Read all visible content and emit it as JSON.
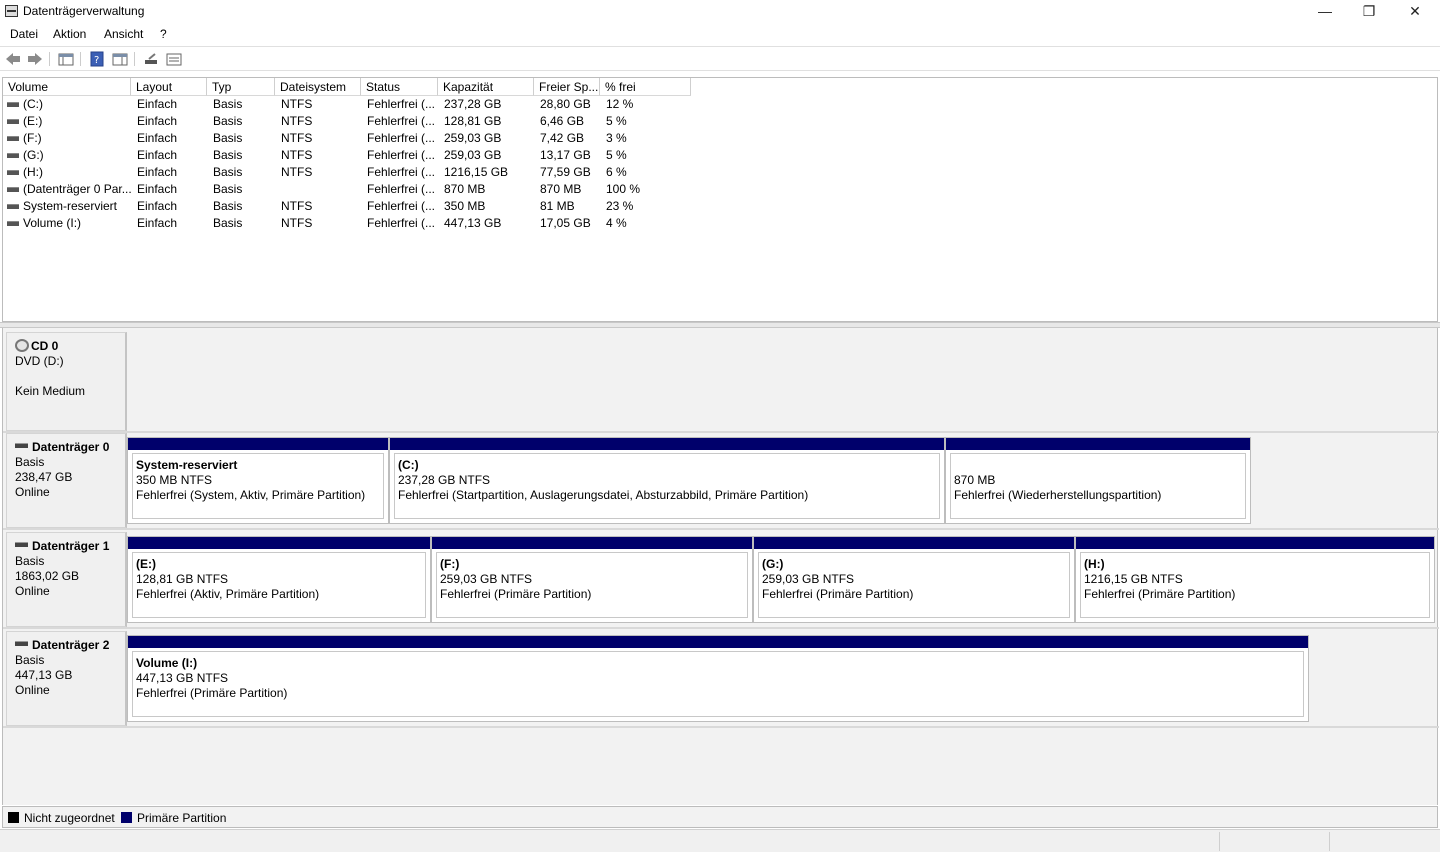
{
  "window": {
    "title": "Datenträgerverwaltung",
    "min": "—",
    "max": "❐",
    "close": "✕"
  },
  "menu": [
    {
      "label": "Datei"
    },
    {
      "label": "Aktion"
    },
    {
      "label": "Ansicht"
    },
    {
      "label": "?"
    }
  ],
  "toolbar": {
    "icons": [
      "back-arrow-icon",
      "forward-arrow-icon",
      "console-tree-icon",
      "help-icon",
      "properties-panel-icon",
      "rescan-disks-icon",
      "volume-list-icon"
    ]
  },
  "volume_table": {
    "columns": [
      "Volume",
      "Layout",
      "Typ",
      "Dateisystem",
      "Status",
      "Kapazität",
      "Freier Sp...",
      "% frei"
    ],
    "rows": [
      [
        "(C:)",
        "Einfach",
        "Basis",
        "NTFS",
        "Fehlerfrei (...",
        "237,28 GB",
        "28,80 GB",
        "12 %"
      ],
      [
        "(E:)",
        "Einfach",
        "Basis",
        "NTFS",
        "Fehlerfrei (...",
        "128,81 GB",
        "6,46 GB",
        "5 %"
      ],
      [
        "(F:)",
        "Einfach",
        "Basis",
        "NTFS",
        "Fehlerfrei (...",
        "259,03 GB",
        "7,42 GB",
        "3 %"
      ],
      [
        "(G:)",
        "Einfach",
        "Basis",
        "NTFS",
        "Fehlerfrei (...",
        "259,03 GB",
        "13,17 GB",
        "5 %"
      ],
      [
        "(H:)",
        "Einfach",
        "Basis",
        "NTFS",
        "Fehlerfrei (...",
        "1216,15 GB",
        "77,59 GB",
        "6 %"
      ],
      [
        "(Datenträger 0 Par...",
        "Einfach",
        "Basis",
        "",
        "Fehlerfrei (...",
        "870 MB",
        "870 MB",
        "100 %"
      ],
      [
        "System-reserviert",
        "Einfach",
        "Basis",
        "NTFS",
        "Fehlerfrei (...",
        "350 MB",
        "81 MB",
        "23 %"
      ],
      [
        "Volume (I:)",
        "Einfach",
        "Basis",
        "NTFS",
        "Fehlerfrei (...",
        "447,13 GB",
        "17,05 GB",
        "4 %"
      ]
    ]
  },
  "disks": {
    "cd0": {
      "name": "CD 0",
      "line1": "DVD (D:)",
      "line2": "",
      "line3": "Kein Medium"
    },
    "disk0": {
      "name": "Datenträger 0",
      "line1": "Basis",
      "line2": "238,47 GB",
      "line3": "Online",
      "partitions": [
        {
          "name": "System-reserviert",
          "size": "350 MB NTFS",
          "status": "Fehlerfrei (System, Aktiv, Primäre Partition)"
        },
        {
          "name": "(C:)",
          "size": "237,28 GB NTFS",
          "status": "Fehlerfrei (Startpartition, Auslagerungsdatei, Absturzabbild, Primäre Partition)"
        },
        {
          "name": "",
          "size": "870 MB",
          "status": "Fehlerfrei (Wiederherstellungspartition)"
        }
      ]
    },
    "disk1": {
      "name": "Datenträger 1",
      "line1": "Basis",
      "line2": "1863,02 GB",
      "line3": "Online",
      "partitions": [
        {
          "name": "(E:)",
          "size": "128,81 GB NTFS",
          "status": "Fehlerfrei (Aktiv, Primäre Partition)"
        },
        {
          "name": "(F:)",
          "size": "259,03 GB NTFS",
          "status": "Fehlerfrei (Primäre Partition)"
        },
        {
          "name": "(G:)",
          "size": "259,03 GB NTFS",
          "status": "Fehlerfrei (Primäre Partition)"
        },
        {
          "name": "(H:)",
          "size": "1216,15 GB NTFS",
          "status": "Fehlerfrei (Primäre Partition)"
        }
      ]
    },
    "disk2": {
      "name": "Datenträger 2",
      "line1": "Basis",
      "line2": "447,13 GB",
      "line3": "Online",
      "partitions": [
        {
          "name": "Volume  (I:)",
          "size": "447,13 GB NTFS",
          "status": "Fehlerfrei (Primäre Partition)"
        }
      ]
    }
  },
  "legend": {
    "unallocated": {
      "label": "Nicht zugeordnet",
      "color": "#000000"
    },
    "primary": {
      "label": "Primäre Partition",
      "color": "#00006b"
    }
  }
}
